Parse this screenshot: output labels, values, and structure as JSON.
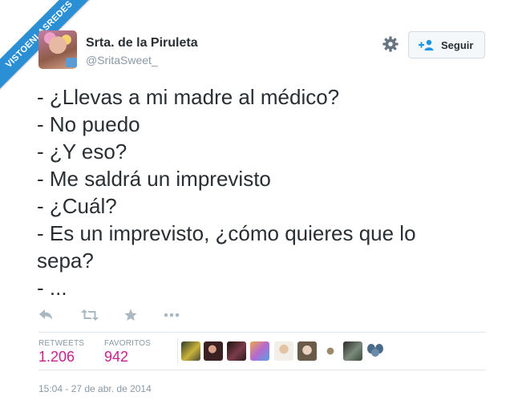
{
  "watermark": "VISTOENLASREDES",
  "author": {
    "name": "Srta. de la Piruleta",
    "handle": "@SritaSweet_"
  },
  "header": {
    "settings_icon": "gear-icon",
    "follow_label": "Seguir",
    "follow_icon": "add-user-icon"
  },
  "tweet": {
    "lines": [
      "- ¿Llevas a mi madre al médico?",
      "- No puedo",
      "- ¿Y eso?",
      "- Me saldrá un imprevisto",
      "- ¿Cuál?",
      "- Es un imprevisto, ¿cómo quieres que lo",
      "sepa?",
      "- ..."
    ]
  },
  "actions": [
    "reply-icon",
    "retweet-icon",
    "favorite-icon",
    "more-icon"
  ],
  "stats": {
    "retweets_label": "RETWEETS",
    "retweets_value": "1.206",
    "favorites_label": "FAVORITOS",
    "favorites_value": "942"
  },
  "favoriters_count": 10,
  "timestamp": "15:04 - 27 de abr. de 2014",
  "colors": {
    "accent": "#cc1f8a",
    "watermark": "#2a8fd4",
    "muted": "#8899a6",
    "text": "#292f33"
  }
}
